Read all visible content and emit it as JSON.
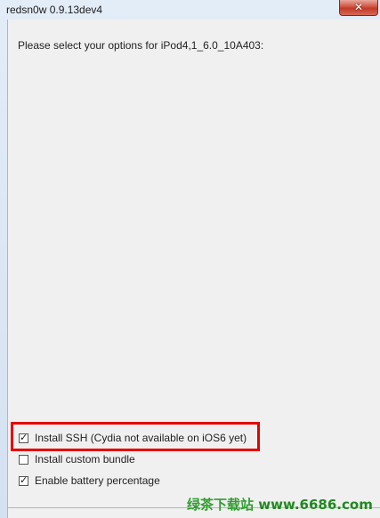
{
  "window": {
    "title": "redsn0w 0.9.13dev4",
    "close_glyph": "✕"
  },
  "prompt": "Please select your options for iPod4,1_6.0_10A403:",
  "options": [
    {
      "label": "Install SSH (Cydia not available on iOS6 yet)",
      "checked": true
    },
    {
      "label": "Install custom bundle",
      "checked": false
    },
    {
      "label": "Enable battery percentage",
      "checked": true
    }
  ],
  "watermark": {
    "site_name": "绿茶下载站",
    "url": "www.6686.com"
  },
  "colors": {
    "highlight": "#e60000",
    "watermark": "#2f9e2f"
  },
  "icons": {
    "close": "close-icon",
    "check": "checkmark-icon"
  }
}
